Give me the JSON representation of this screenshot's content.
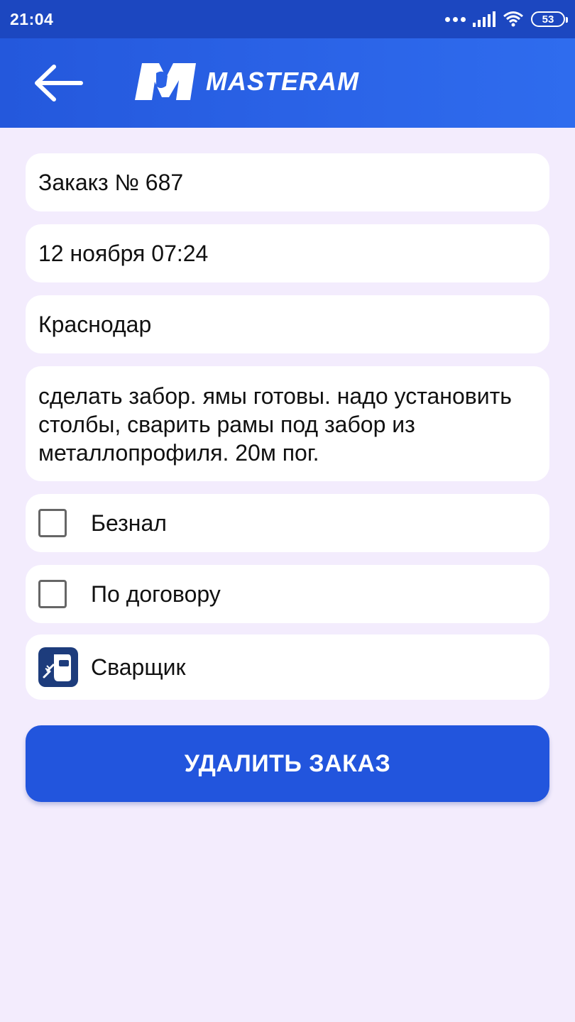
{
  "status_bar": {
    "time": "21:04",
    "battery": "53",
    "icons": [
      "more-dots-icon",
      "signal-icon",
      "wifi-icon",
      "battery-icon"
    ]
  },
  "header": {
    "back_icon": "arrow-left-icon",
    "logo_text": "MASTERAM",
    "accent_color": "#2458dc"
  },
  "order": {
    "number": "Закакз № 687",
    "datetime": "12 ноября 07:24",
    "city": "Краснодар",
    "description": "сделать забор. ямы готовы. надо установить столбы, сварить рамы под забор из металлопрофиля. 20м пог.",
    "cashless": {
      "label": "Безнал",
      "checked": false
    },
    "contract": {
      "label": "По договору",
      "checked": false
    },
    "category": {
      "label": "Сварщик",
      "icon": "welder-mask-icon"
    }
  },
  "actions": {
    "delete_label": "УДАЛИТЬ ЗАКАЗ",
    "button_color": "#2255dd"
  }
}
